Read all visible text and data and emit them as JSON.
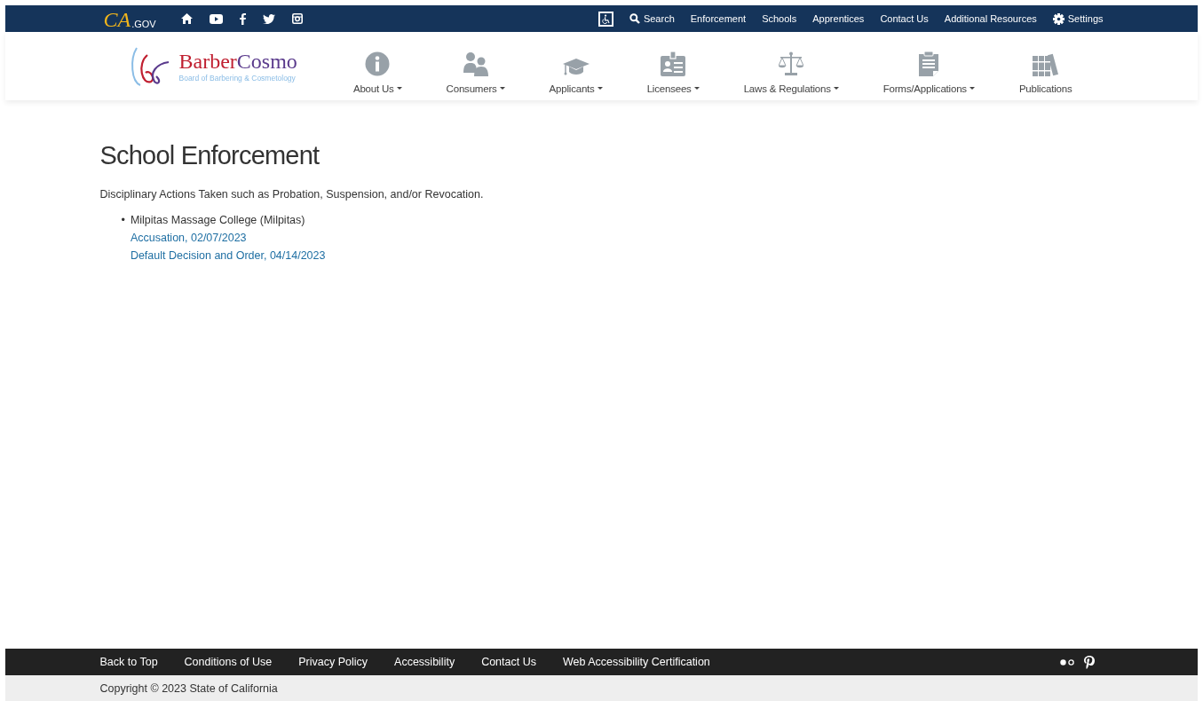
{
  "utility_bar": {
    "logo": {
      "parts": [
        "CA",
        ".GOV"
      ]
    },
    "social": [
      {
        "kind": "home"
      },
      {
        "kind": "youtube"
      },
      {
        "kind": "facebook"
      },
      {
        "kind": "twitter"
      },
      {
        "kind": "instagram"
      }
    ],
    "links": [
      {
        "kind": "accessibility"
      },
      {
        "kind": "search",
        "label": "Search"
      },
      {
        "kind": "text",
        "label": "Enforcement"
      },
      {
        "kind": "text",
        "label": "Schools"
      },
      {
        "kind": "text",
        "label": "Apprentices"
      },
      {
        "kind": "text",
        "label": "Contact Us"
      },
      {
        "kind": "text",
        "label": "Additional Resources"
      },
      {
        "kind": "settings",
        "label": "Settings"
      }
    ]
  },
  "header": {
    "logo": {
      "name_parts": [
        "Barber",
        "Cosmo"
      ],
      "subtitle": "Board of Barbering & Cosmetology"
    },
    "nav": [
      {
        "kind": "info",
        "label": "About Us",
        "has_menu": true
      },
      {
        "kind": "people",
        "label": "Consumers",
        "has_menu": true
      },
      {
        "kind": "cap",
        "label": "Applicants",
        "has_menu": true
      },
      {
        "kind": "badge",
        "label": "Licensees",
        "has_menu": true
      },
      {
        "kind": "scale",
        "label": "Laws & Regulations",
        "has_menu": true
      },
      {
        "kind": "clipboard",
        "label": "Forms/Applications",
        "has_menu": true
      },
      {
        "kind": "books",
        "label": "Publications",
        "has_menu": false
      }
    ]
  },
  "main": {
    "title": "School Enforcement",
    "intro": "Disciplinary Actions Taken such as Probation, Suspension, and/or Revocation.",
    "schools": [
      {
        "marker": "•",
        "name": "Milpitas Massage College (Milpitas)",
        "documents": [
          "Accusation, 02/07/2023",
          "Default Decision and Order, 04/14/2023"
        ]
      }
    ]
  },
  "footer": {
    "links": [
      "Back to Top",
      "Conditions of Use",
      "Privacy Policy",
      "Accessibility",
      "Contact Us",
      "Web Accessibility Certification"
    ],
    "social": [
      {
        "kind": "flickr"
      },
      {
        "kind": "pinterest"
      }
    ],
    "copyright": "Copyright © 2023 State of California"
  }
}
